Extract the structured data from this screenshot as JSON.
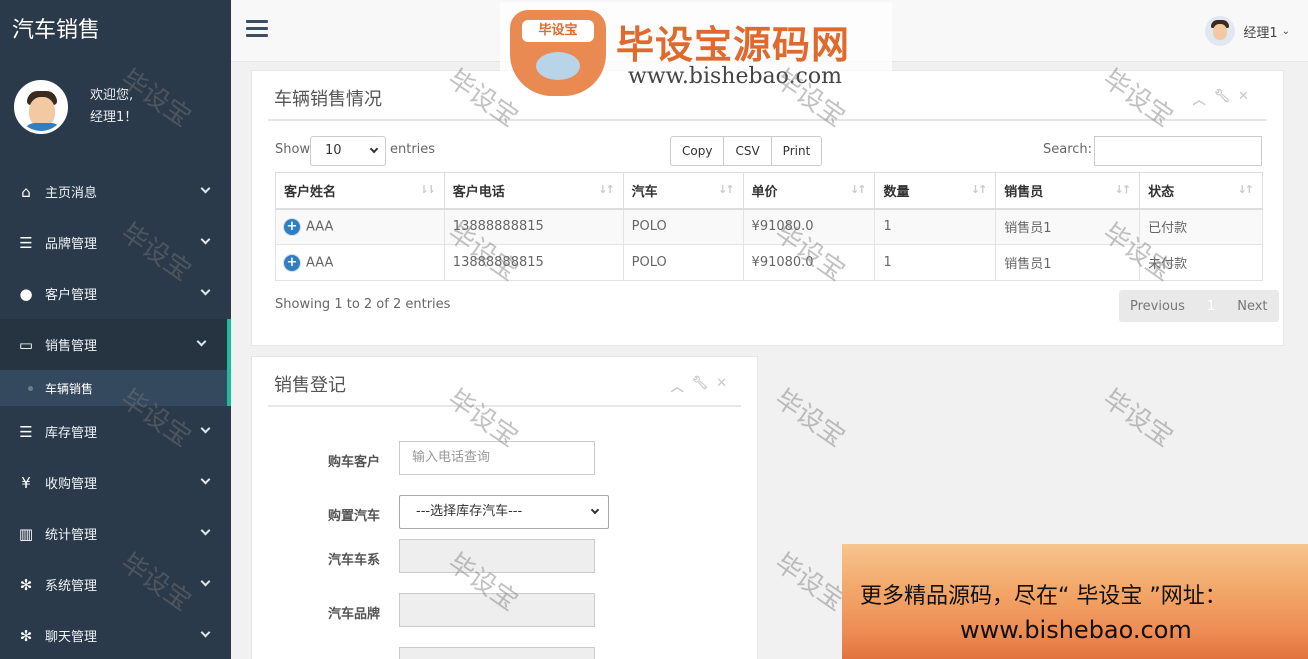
{
  "sidebar": {
    "brand": "汽车销售",
    "welcome_line1": "欢迎您,",
    "welcome_line2": "经理1！",
    "menu": [
      {
        "label": "主页消息",
        "icon": "home-icon"
      },
      {
        "label": "品牌管理",
        "icon": "list-icon"
      },
      {
        "label": "客户管理",
        "icon": "user-icon"
      },
      {
        "label": "销售管理",
        "icon": "monitor-icon",
        "active": true
      },
      {
        "label": "库存管理",
        "icon": "list-icon"
      },
      {
        "label": "收购管理",
        "icon": "yen-icon"
      },
      {
        "label": "统计管理",
        "icon": "bar-chart-icon"
      },
      {
        "label": "系统管理",
        "icon": "gear-icon"
      },
      {
        "label": "聊天管理",
        "icon": "gear-icon"
      }
    ],
    "submenu": {
      "label": "车辆销售"
    }
  },
  "topbar": {
    "user_name": "经理1",
    "caret": "⌄"
  },
  "logo": {
    "badge_text": "毕设宝",
    "title": "毕设宝源码网",
    "url": "www.bishebao.com"
  },
  "sales_panel": {
    "title": "车辆销售情况",
    "show_label": "Show",
    "entries_label": "entries",
    "length_value": "10",
    "buttons": [
      "Copy",
      "CSV",
      "Print"
    ],
    "search_label": "Search:",
    "columns": [
      "客户姓名",
      "客户电话",
      "汽车",
      "单价",
      "数量",
      "销售员",
      "状态"
    ],
    "rows": [
      [
        "AAA",
        "13888888815",
        "POLO",
        "¥91080.0",
        "1",
        "销售员1",
        "已付款"
      ],
      [
        "AAA",
        "13888888815",
        "POLO",
        "¥91080.0",
        "1",
        "销售员1",
        "未付款"
      ]
    ],
    "info": "Showing 1 to 2 of 2 entries",
    "pager": {
      "previous": "Previous",
      "current": "1",
      "next": "Next"
    }
  },
  "form_panel": {
    "title": "销售登记",
    "customer_label": "购车客户",
    "customer_placeholder": "输入电话查询",
    "car_label": "购置汽车",
    "car_select": "---选择库存汽车---",
    "series_label": "汽车车系",
    "brand_label": "汽车品牌"
  },
  "watermark": "毕设宝",
  "banner": {
    "line1": "更多精品源码，尽在“ 毕设宝 ”网址：",
    "line2": "www.bishebao.com"
  },
  "colors": {
    "sidebar_bg": "#2b3a4a",
    "active_accent": "#1abc9c",
    "link_blue": "#2f7fc1",
    "logo_orange": "#e06a2d"
  }
}
